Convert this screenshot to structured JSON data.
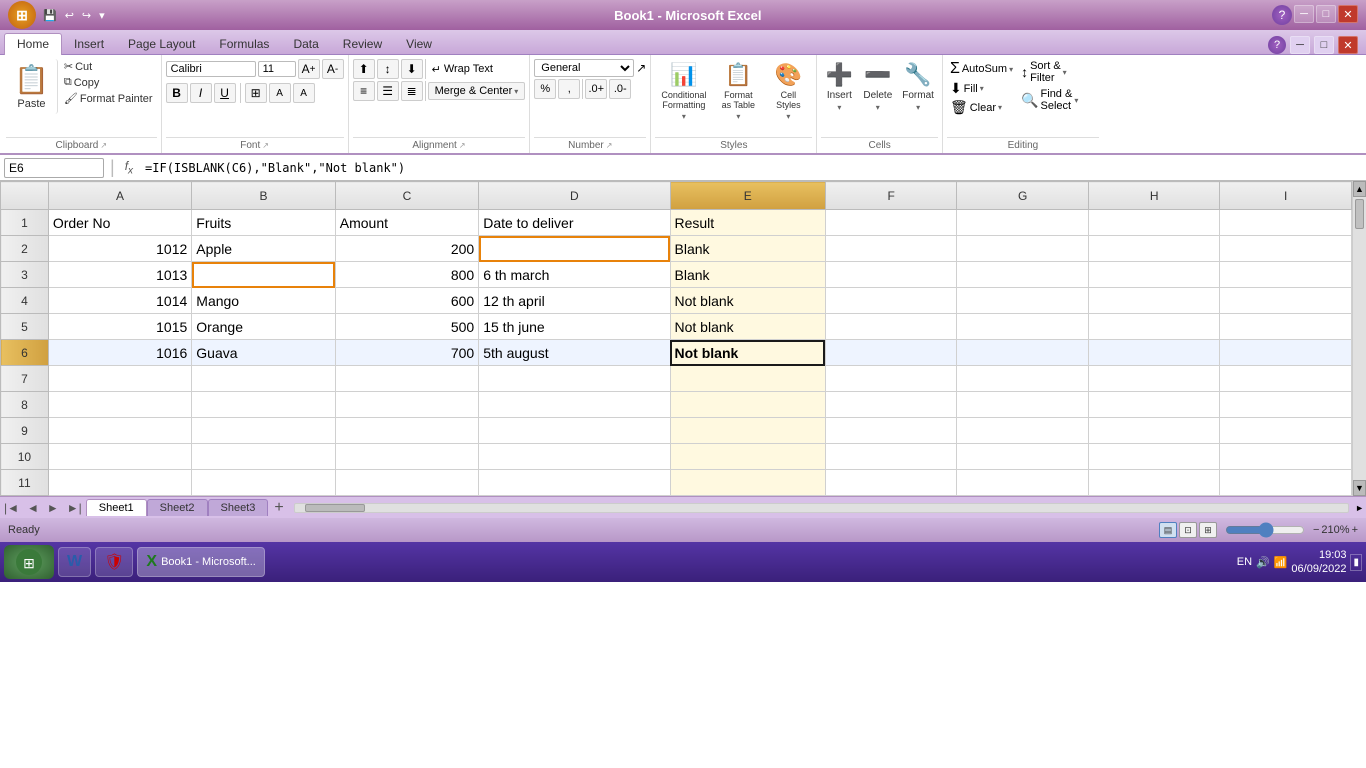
{
  "window": {
    "title": "Book1 - Microsoft Excel",
    "titlebar_btns": [
      "─",
      "□",
      "✕"
    ]
  },
  "ribbon": {
    "tabs": [
      "Home",
      "Insert",
      "Page Layout",
      "Formulas",
      "Data",
      "Review",
      "View"
    ],
    "active_tab": "Home",
    "groups": {
      "clipboard": {
        "label": "Clipboard",
        "paste": "Paste",
        "cut": "Cut",
        "copy": "Copy",
        "format_painter": "Format Painter"
      },
      "font": {
        "label": "Font",
        "font_name": "Calibri",
        "font_size": "11",
        "bold": "B",
        "italic": "I",
        "underline": "U",
        "increase_size": "A↑",
        "decrease_size": "A↓"
      },
      "alignment": {
        "label": "Alignment",
        "wrap_text": "Wrap Text",
        "merge_center": "Merge & Center"
      },
      "number": {
        "label": "Number",
        "format": "General"
      },
      "styles": {
        "label": "Styles",
        "conditional": "Conditional Formatting",
        "format_table": "Format as Table",
        "cell_styles": "Cell Styles"
      },
      "cells": {
        "label": "Cells",
        "insert": "Insert",
        "delete": "Delete",
        "format": "Format"
      },
      "editing": {
        "label": "Editing",
        "autosum": "AutoSum",
        "fill": "Fill",
        "clear": "Clear",
        "sort_filter": "Sort & Filter",
        "find_select": "Find & Select"
      }
    }
  },
  "formula_bar": {
    "cell_ref": "E6",
    "formula": "=IF(ISBLANK(C6),\"Blank\",\"Not blank\")"
  },
  "spreadsheet": {
    "columns": [
      "",
      "A",
      "B",
      "C",
      "D",
      "E",
      "F",
      "G",
      "H",
      "I"
    ],
    "active_cell": "E6",
    "selected_col": "E",
    "rows": [
      {
        "row": 1,
        "A": "Order No",
        "B": "Fruits",
        "C": "Amount",
        "D": "Date to deliver",
        "E": "Result",
        "F": "",
        "G": "",
        "H": "",
        "I": ""
      },
      {
        "row": 2,
        "A": "1012",
        "B": "Apple",
        "C": "200",
        "D": "",
        "E": "Blank",
        "F": "",
        "G": "",
        "H": "",
        "I": "",
        "D_orange": true
      },
      {
        "row": 3,
        "A": "1013",
        "B": "",
        "C": "800",
        "D": "6 th march",
        "E": "Blank",
        "F": "",
        "G": "",
        "H": "",
        "I": "",
        "B_orange": true
      },
      {
        "row": 4,
        "A": "1014",
        "B": "Mango",
        "C": "600",
        "D": "12 th april",
        "E": "Not blank",
        "F": "",
        "G": "",
        "H": "",
        "I": ""
      },
      {
        "row": 5,
        "A": "1015",
        "B": "Orange",
        "C": "500",
        "D": "15 th june",
        "E": "Not blank",
        "F": "",
        "G": "",
        "H": "",
        "I": ""
      },
      {
        "row": 6,
        "A": "1016",
        "B": "Guava",
        "C": "700",
        "D": "5th august",
        "E": "Not blank",
        "F": "",
        "G": "",
        "H": "",
        "I": "",
        "E_active": true
      },
      {
        "row": 7,
        "A": "",
        "B": "",
        "C": "",
        "D": "",
        "E": "",
        "F": "",
        "G": "",
        "H": "",
        "I": ""
      },
      {
        "row": 8,
        "A": "",
        "B": "",
        "C": "",
        "D": "",
        "E": "",
        "F": "",
        "G": "",
        "H": "",
        "I": ""
      },
      {
        "row": 9,
        "A": "",
        "B": "",
        "C": "",
        "D": "",
        "E": "",
        "F": "",
        "G": "",
        "H": "",
        "I": ""
      },
      {
        "row": 10,
        "A": "",
        "B": "",
        "C": "",
        "D": "",
        "E": "",
        "F": "",
        "G": "",
        "H": "",
        "I": ""
      },
      {
        "row": 11,
        "A": "",
        "B": "",
        "C": "",
        "D": "",
        "E": "",
        "F": "",
        "G": "",
        "H": "",
        "I": ""
      }
    ]
  },
  "sheet_tabs": [
    "Sheet1",
    "Sheet2",
    "Sheet3"
  ],
  "active_sheet": "Sheet1",
  "status": {
    "ready": "Ready",
    "zoom": "210%"
  },
  "taskbar": {
    "time": "19:03",
    "date": "06/09/2022",
    "language": "EN",
    "items": [
      "W",
      "X"
    ]
  }
}
